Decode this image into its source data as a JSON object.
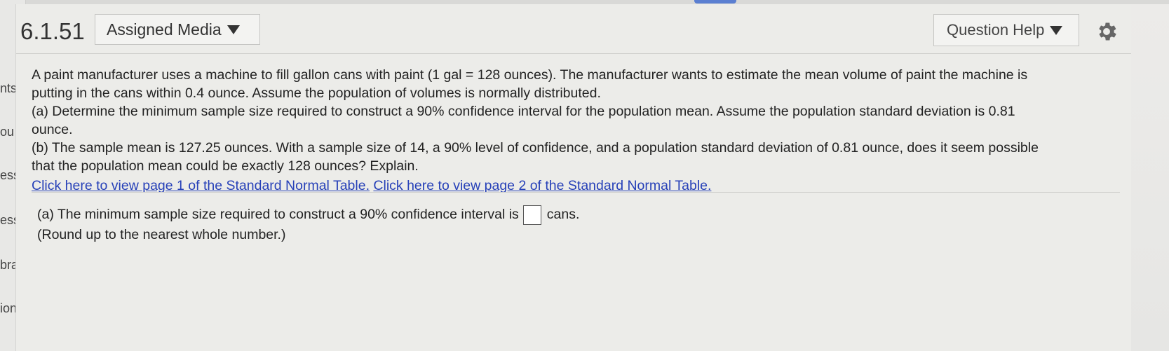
{
  "header": {
    "question_number": "6.1.51",
    "assigned_media_label": "Assigned Media",
    "question_help_label": "Question Help"
  },
  "leftnav": [
    "nts",
    "ou",
    "ess",
    "ess",
    "bra",
    "ions"
  ],
  "problem": {
    "intro_line1": "A paint manufacturer uses a machine to fill gallon cans with paint (1 gal = 128 ounces). The manufacturer wants to estimate the mean volume of paint the machine is",
    "intro_line2": "putting in the cans within 0.4 ounce. Assume the population of volumes is normally distributed.",
    "part_a_line1": "(a) Determine the minimum sample size required to construct a 90% confidence interval for the population mean. Assume the population standard deviation is 0.81",
    "part_a_line2": "ounce.",
    "part_b_line1": "(b) The sample mean is 127.25 ounces. With a sample size of 14, a 90% level of confidence, and a population standard deviation of 0.81 ounce, does it seem possible",
    "part_b_line2": "that the population mean could be exactly 128 ounces? Explain.",
    "link1": "Click here to view page 1 of the Standard Normal Table.",
    "link2": "Click here to view page 2 of the Standard Normal Table."
  },
  "answer": {
    "prompt_before": "(a) The minimum sample size required to construct a 90% confidence interval is",
    "prompt_after": "cans.",
    "input_value": "",
    "note": "(Round up to the nearest whole number.)"
  }
}
